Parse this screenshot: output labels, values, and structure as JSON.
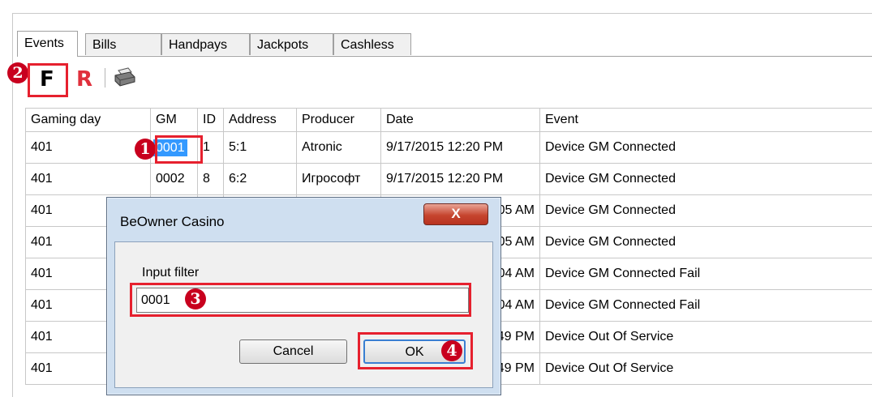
{
  "tabs": [
    "Events",
    "Bills",
    "Handpays",
    "Jackpots",
    "Cashless"
  ],
  "toolbar": {
    "filter_label": "F",
    "reset_label": "R",
    "print_icon": "printer-icon"
  },
  "steps": [
    "1",
    "2",
    "3",
    "4"
  ],
  "table": {
    "columns": [
      "Gaming day",
      "GM",
      "ID",
      "Address",
      "Producer",
      "Date",
      "Event"
    ],
    "rows": [
      [
        "401",
        "0001",
        "1",
        "5:1",
        "Atronic",
        "9/17/2015 12:20 PM",
        "Device GM Connected"
      ],
      [
        "401",
        "0002",
        "8",
        "6:2",
        "Игрософт",
        "9/17/2015 12:20 PM",
        "Device GM Connected"
      ],
      [
        "401",
        "",
        "",
        "",
        "",
        "05 AM",
        "Device GM Connected"
      ],
      [
        "401",
        "",
        "",
        "",
        "",
        "05 AM",
        "Device GM Connected"
      ],
      [
        "401",
        "",
        "",
        "",
        "",
        "04 AM",
        "Device GM Connected Fail"
      ],
      [
        "401",
        "",
        "",
        "",
        "",
        "04 AM",
        "Device GM Connected Fail"
      ],
      [
        "401",
        "",
        "",
        "",
        "",
        "49 PM",
        "Device Out Of Service"
      ],
      [
        "401",
        "",
        "",
        "",
        "",
        "49 PM",
        "Device Out Of Service"
      ]
    ]
  },
  "dialog": {
    "title": "BeOwner Casino",
    "close_label": "X",
    "input_label": "Input filter",
    "input_value": "0001",
    "cancel_label": "Cancel",
    "ok_label": "OK"
  },
  "colors": {
    "highlight": "#e6202e",
    "step_badge": "#c8001e",
    "selection": "#3399ff",
    "dialog_frame": "#cfdff0"
  }
}
